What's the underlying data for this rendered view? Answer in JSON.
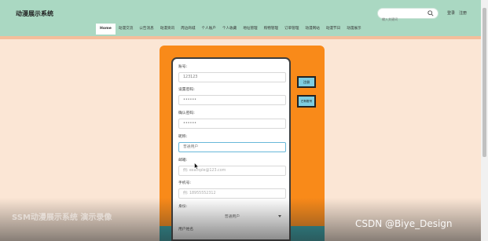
{
  "header": {
    "site_title": "动漫展示系统",
    "search_placeholder": "输入关键词",
    "login_label": "登录",
    "register_label": "注册"
  },
  "nav": {
    "items": [
      {
        "label": "Home",
        "active": true
      },
      {
        "label": "动漫交流"
      },
      {
        "label": "公告消息"
      },
      {
        "label": "动漫资讯"
      },
      {
        "label": "周边商城"
      },
      {
        "label": "个人账户"
      },
      {
        "label": "个人收藏"
      },
      {
        "label": "地址管理"
      },
      {
        "label": "购物管理"
      },
      {
        "label": "订单管理"
      },
      {
        "label": "动漫网站"
      },
      {
        "label": "动漫节日"
      },
      {
        "label": "动漫展示"
      }
    ]
  },
  "form": {
    "account": {
      "label": "账号:",
      "value": "123123"
    },
    "password": {
      "label": "设置密码:",
      "value": "••••••"
    },
    "confirm_password": {
      "label": "确认密码:",
      "value": "••••••"
    },
    "nickname": {
      "label": "昵称:",
      "value": "普通用户"
    },
    "email": {
      "label": "邮箱:",
      "placeholder": "例: example@123.com"
    },
    "phone": {
      "label": "手机号:",
      "placeholder": "例: 18955552312"
    },
    "identity": {
      "label": "身份:",
      "value": "普通用户"
    },
    "username": {
      "label": "用户姓名"
    }
  },
  "buttons": {
    "register": "注册",
    "has_account": "已有账号"
  },
  "watermarks": {
    "left": "SSM动漫展示系统 演示录像",
    "right": "CSDN @Biye_Design"
  },
  "colors": {
    "header_bg": "#aad8c2",
    "page_bg": "#fbe6d5",
    "panel": "#f98a19",
    "teal": "#2e9ba1",
    "button": "#7ecde0"
  },
  "icons": [
    "search-icon",
    "caret-down-icon",
    "mouse-cursor-icon"
  ]
}
